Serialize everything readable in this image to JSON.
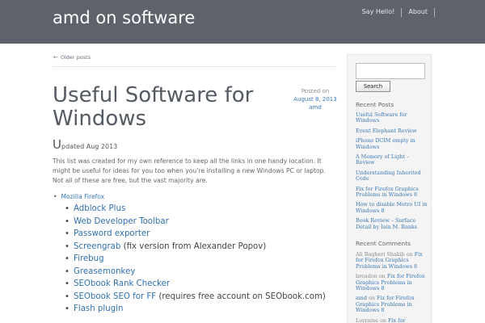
{
  "site": {
    "title": "amd on software",
    "nav": [
      "Say Hello!",
      "About"
    ]
  },
  "main": {
    "older_posts": "Older posts",
    "post": {
      "title": "Useful Software for Windows",
      "meta": {
        "posted_on": "Posted on",
        "date": "August 8, 2013",
        "author": "amd"
      },
      "updated_first": "U",
      "updated_rest": "pdated Aug 2013",
      "intro": "This list was created for my own reference to keep all the links in one handy location. It might be useful for ideas for you too when you’re installing a new Windows PC or laptop. Not all of these are free, but the vast majority are.",
      "top_item": "Mozilla Firefox",
      "sub_items": [
        {
          "link": "Adblock Plus",
          "note": ""
        },
        {
          "link": "Web Developer Toolbar",
          "note": ""
        },
        {
          "link": "Password exporter",
          "note": ""
        },
        {
          "link": "Screengrab",
          "note": " (fix version from Alexander Popov)"
        },
        {
          "link": "Firebug",
          "note": ""
        },
        {
          "link": "Greasemonkey",
          "note": ""
        },
        {
          "link": "SEObook Rank Checker",
          "note": ""
        },
        {
          "link": "SEObook SEO for FF",
          "note": " (requires free account on SEObook.com)"
        },
        {
          "link": "Flash plugin",
          "note": ""
        }
      ]
    }
  },
  "sidebar": {
    "search_button": "Search",
    "recent_posts_title": "Recent Posts",
    "recent_posts": [
      "Useful Software for Windows",
      "Event Elephant Review",
      "iPhone DCIM empty in Windows",
      "A Memory of Light – Review",
      "Understanding Inherited Code",
      "Fix for Firefox Graphics Problems in Windows 8",
      "How to disable Metro UI in Windows 8",
      "Book Review – Surface Detail by Iain M. Banks"
    ],
    "recent_comments_title": "Recent Comments",
    "recent_comments": [
      {
        "author": "Ali Bagheri Shakib",
        "on": " on ",
        "post": "Fix for Firefox Graphics Problems in Windows 8",
        "author_link": false
      },
      {
        "author": "breadon",
        "on": " on ",
        "post": "Fix for Firefox Graphics Problems in Windows 8",
        "author_link": false
      },
      {
        "author": "amd",
        "on": " on ",
        "post": "Fix for Firefox Graphics Problems in Windows 8",
        "author_link": true
      },
      {
        "author": "Lorraine",
        "on": " on ",
        "post": "Fix for",
        "author_link": false
      }
    ]
  },
  "icons": {
    "older_posts": "left-arrow-icon",
    "list_bullet": "bullet-icon"
  }
}
